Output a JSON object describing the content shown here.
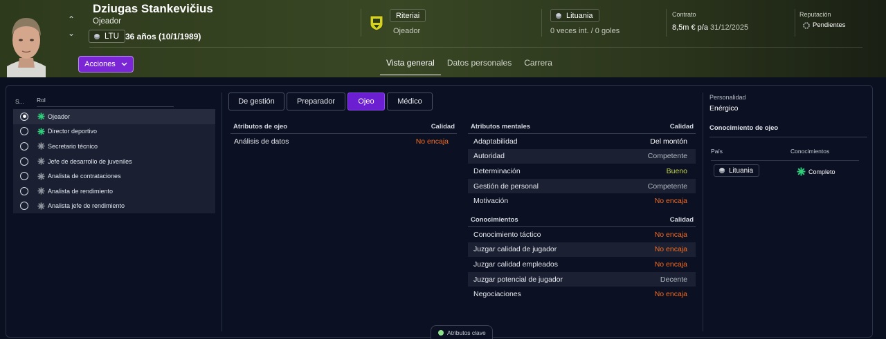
{
  "header": {
    "name": "Dziugas Stankevičius",
    "role": "Ojeador",
    "nation_code": "LTU",
    "age": "36 años (10/1/1989)",
    "actions_label": "Acciones",
    "club": "Riteriai",
    "club_role": "Ojeador",
    "country": "Lituania",
    "caps": "0 veces int. / 0 goles",
    "contract_label": "Contrato",
    "contract_wage": "8,5m € p/a",
    "contract_date": "31/12/2025",
    "reputation_label": "Reputación",
    "reputation_value": "Pendientes"
  },
  "tabs": [
    "Vista general",
    "Datos personales",
    "Carrera"
  ],
  "roles": {
    "col_s": "S...",
    "col_role": "Rol",
    "items": [
      {
        "label": "Ojeador",
        "selected": true,
        "icon": "green"
      },
      {
        "label": "Director deportivo",
        "selected": false,
        "icon": "green"
      },
      {
        "label": "Secretario técnico",
        "selected": false,
        "icon": "grey"
      },
      {
        "label": "Jefe de desarrollo de juveniles",
        "selected": false,
        "icon": "grey"
      },
      {
        "label": "Analista de contrataciones",
        "selected": false,
        "icon": "grey"
      },
      {
        "label": "Analista de rendimiento",
        "selected": false,
        "icon": "grey"
      },
      {
        "label": "Analista jefe de rendimiento",
        "selected": false,
        "icon": "grey"
      }
    ]
  },
  "segments": [
    "De gestión",
    "Preparador",
    "Ojeo",
    "Médico"
  ],
  "scout_attrs": {
    "title": "Atributos de ojeo",
    "quality": "Calidad",
    "rows": [
      {
        "name": "Análisis de datos",
        "value": "No encaja",
        "tone": "bad"
      }
    ]
  },
  "mental_attrs": {
    "title": "Atributos mentales",
    "quality": "Calidad",
    "rows": [
      {
        "name": "Adaptabilidad",
        "value": "Del montón",
        "tone": "mid"
      },
      {
        "name": "Autoridad",
        "value": "Competente",
        "tone": "ok"
      },
      {
        "name": "Determinación",
        "value": "Bueno",
        "tone": "good"
      },
      {
        "name": "Gestión de personal",
        "value": "Competente",
        "tone": "ok"
      },
      {
        "name": "Motivación",
        "value": "No encaja",
        "tone": "bad"
      }
    ]
  },
  "knowledge_attrs": {
    "title": "Conocimientos",
    "quality": "Calidad",
    "rows": [
      {
        "name": "Conocimiento táctico",
        "value": "No encaja",
        "tone": "bad"
      },
      {
        "name": "Juzgar calidad de jugador",
        "value": "No encaja",
        "tone": "bad"
      },
      {
        "name": "Juzgar calidad empleados",
        "value": "No encaja",
        "tone": "bad"
      },
      {
        "name": "Juzgar potencial de jugador",
        "value": "Decente",
        "tone": "ok"
      },
      {
        "name": "Negociaciones",
        "value": "No encaja",
        "tone": "bad"
      }
    ]
  },
  "personality": {
    "label": "Personalidad",
    "value": "Enérgico"
  },
  "scout_knowledge": {
    "title": "Conocimiento de ojeo",
    "col_country": "País",
    "col_knowledge": "Conocimientos",
    "country": "Lituania",
    "level": "Completo"
  },
  "key_attributes_label": "Atributos clave",
  "colors": {
    "accent": "#6b1fd1",
    "bad": "#f26b24",
    "good": "#c7d94a",
    "header_bg": "#394725"
  }
}
